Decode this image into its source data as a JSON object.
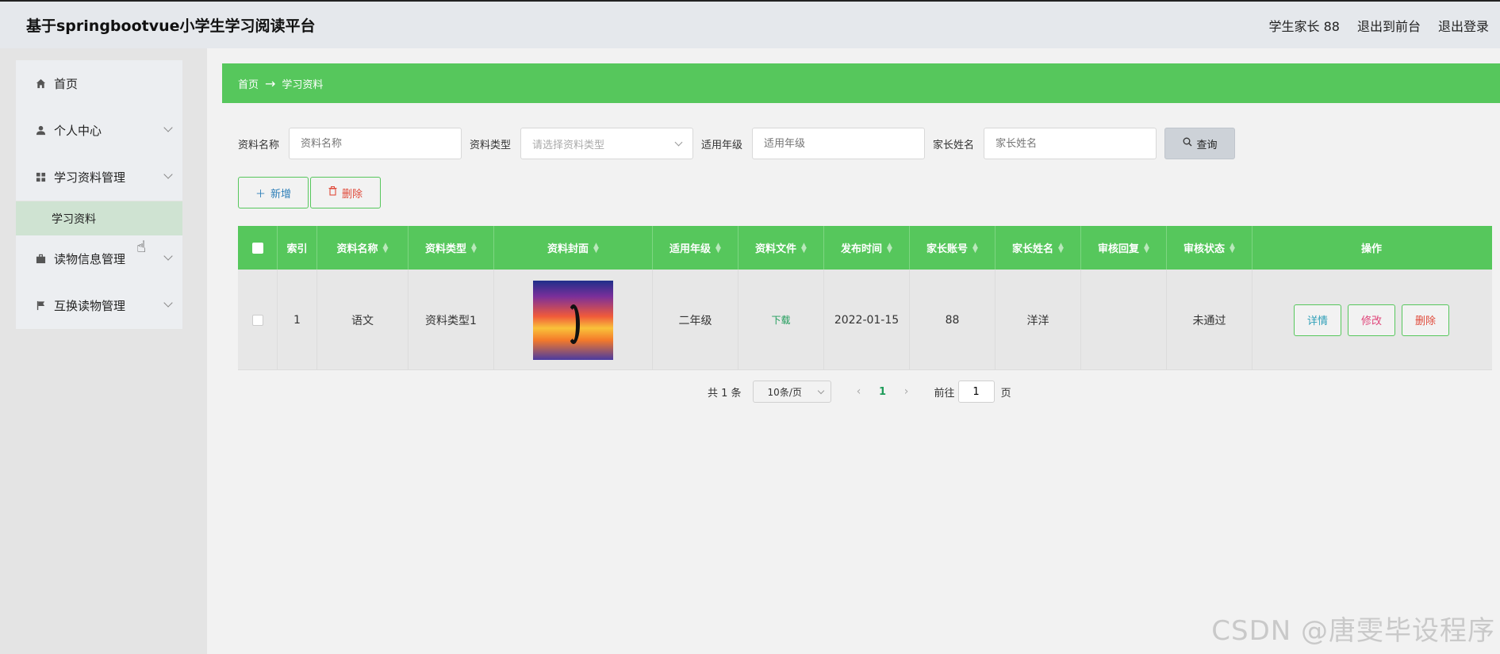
{
  "header": {
    "app_title": "基于springbootvue小学生学习阅读平台",
    "user_label": "学生家长 88",
    "front_link": "退出到前台",
    "logout_link": "退出登录"
  },
  "sidebar": {
    "items": [
      {
        "label": "首页",
        "icon": "home-icon"
      },
      {
        "label": "个人中心",
        "icon": "user-icon"
      },
      {
        "label": "学习资料管理",
        "icon": "grid-icon"
      },
      {
        "label": "读物信息管理",
        "icon": "briefcase-icon"
      },
      {
        "label": "互换读物管理",
        "icon": "flag-icon"
      }
    ],
    "sub_item": "学习资料"
  },
  "breadcrumb": {
    "home": "首页",
    "arrow": "→",
    "current": "学习资料"
  },
  "search": {
    "name_label": "资料名称",
    "name_placeholder": "资料名称",
    "type_label": "资料类型",
    "type_placeholder": "请选择资料类型",
    "grade_label": "适用年级",
    "grade_placeholder": "适用年级",
    "parent_label": "家长姓名",
    "parent_placeholder": "家长姓名",
    "query_button": "查询"
  },
  "actions": {
    "add": "新增",
    "delete": "删除"
  },
  "table": {
    "columns": [
      "索引",
      "资料名称",
      "资料类型",
      "资料封面",
      "适用年级",
      "资料文件",
      "发布时间",
      "家长账号",
      "家长姓名",
      "审核回复",
      "审核状态",
      "操作"
    ],
    "rows": [
      {
        "index": "1",
        "name": "语文",
        "type": "资料类型1",
        "grade": "二年级",
        "file": "下载",
        "time": "2022-01-15",
        "account": "88",
        "parent": "洋洋",
        "reply": "",
        "status": "未通过",
        "ops": {
          "detail": "详情",
          "edit": "修改",
          "remove": "删除"
        }
      }
    ]
  },
  "pagination": {
    "total": "共 1 条",
    "page_size": "10条/页",
    "current_page": "1",
    "goto_label": "前往",
    "goto_value": "1",
    "unit": "页"
  },
  "watermark": "CSDN @唐雯毕设程序",
  "colors": {
    "accent": "#56c75c",
    "header_bg": "#e5e8ec"
  }
}
